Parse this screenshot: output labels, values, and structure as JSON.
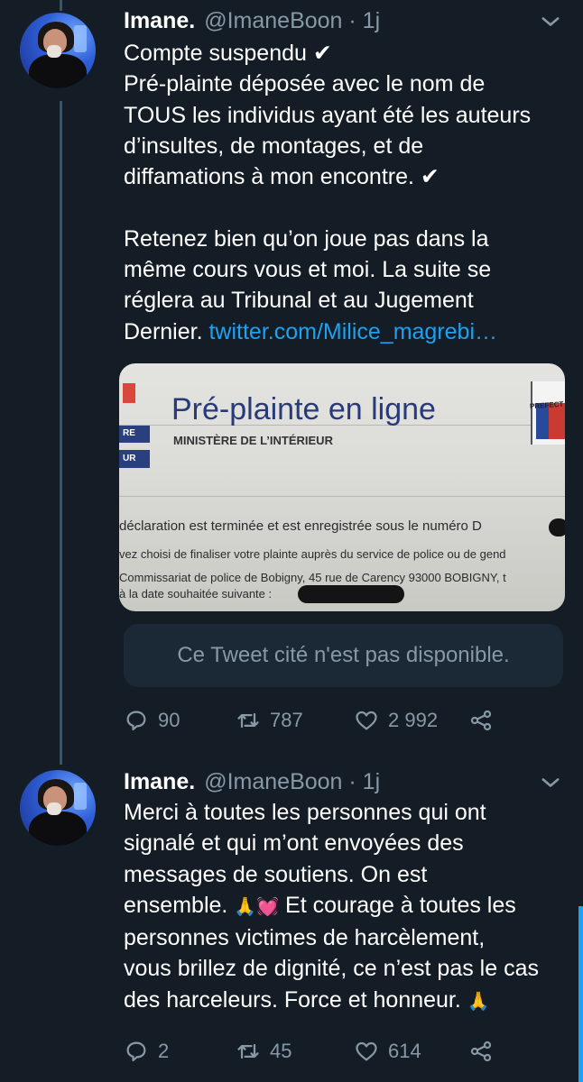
{
  "tweets": [
    {
      "name": "Imane.",
      "handle": "@ImaneBoon · 1j",
      "text": {
        "line1": "Compte suspendu ",
        "check": "✔",
        "line2": "\nPré-plainte déposée avec le nom de\nTOUS les individus ayant été les auteurs\nd’insultes, de montages, et de\ndiffamations à mon encontre. ",
        "check2": "✔",
        "line3": "\n\nRetenez bien qu’on joue pas dans la\nmême cours vous et moi. La suite se\nréglera au Tribunal et au Jugement\nDernier. ",
        "link": "twitter.com/Milice_magrebi…"
      },
      "photo": {
        "title": "Pré-plainte en ligne",
        "subtitle": "MINISTÈRE DE L’INTÉRIEUR",
        "side_labels": [
          "RE",
          "UR"
        ],
        "emblem_text": "PREFECT",
        "lines": [
          "déclaration est terminée et est enregistrée sous le numéro D",
          "vez choisi de finaliser votre plainte auprès du service de police ou de gend",
          "Commissariat de police de Bobigny, 45 rue de Carency 93000 BOBIGNY, t",
          "à la date souhaitée suivante :"
        ]
      },
      "quoted": "Ce Tweet cité n'est pas disponible.",
      "counts": {
        "replies": "90",
        "retweets": "787",
        "likes": "2 992"
      }
    },
    {
      "name": "Imane.",
      "handle": "@ImaneBoon · 1j",
      "text": {
        "part1": "Merci à toutes les personnes qui ont\nsignalé et qui m’ont envoyées des\nmessages de soutiens. On est\nensemble. ",
        "emoji1": "🙏💓",
        "part2": " Et courage à toutes les\npersonnes victimes de harcèlement,\nvous brillez de dignité, ce n’est pas le cas\ndes harceleurs. Force et honneur. ",
        "emoji2": "🙏"
      },
      "counts": {
        "replies": "2",
        "retweets": "45",
        "likes": "614"
      }
    }
  ],
  "colors": {
    "background": "#141d26",
    "link": "#1da1f2",
    "secondary": "#8899a6"
  },
  "icons": [
    "caret-down-icon",
    "reply-icon",
    "retweet-icon",
    "like-icon",
    "share-icon"
  ]
}
